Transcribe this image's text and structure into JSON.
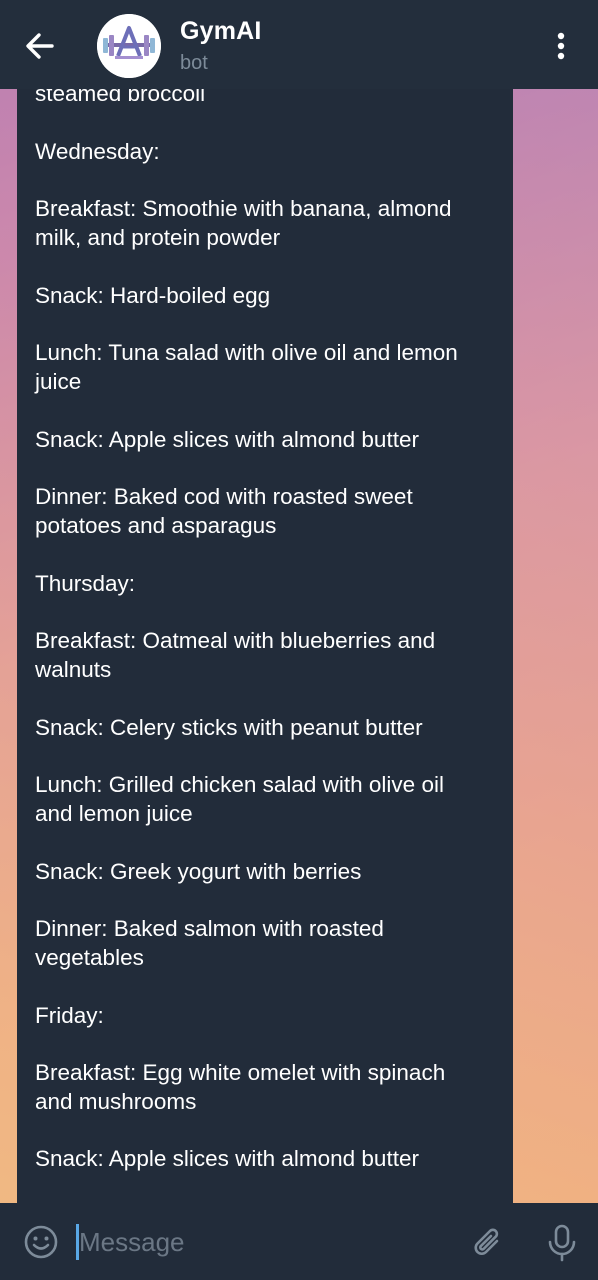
{
  "header": {
    "title": "GymAI",
    "subtitle": "bot",
    "back_icon": "arrow-left-icon",
    "menu_icon": "more-vertical-icon"
  },
  "message": {
    "lines": [
      "steamed broccoli",
      "",
      "Wednesday:",
      "",
      "Breakfast: Smoothie with banana, almond",
      "milk, and protein powder",
      "",
      "Snack: Hard-boiled egg",
      "",
      "Lunch: Tuna salad with olive oil and lemon",
      "juice",
      "",
      "Snack: Apple slices with almond butter",
      "",
      "Dinner: Baked cod with roasted sweet",
      "potatoes and asparagus",
      "",
      "Thursday:",
      "",
      "Breakfast: Oatmeal with blueberries and",
      "walnuts",
      "",
      "Snack: Celery sticks with peanut butter",
      "",
      "Lunch: Grilled chicken salad with olive oil",
      "and lemon juice",
      "",
      "Snack: Greek yogurt with berries",
      "",
      "Dinner: Baked salmon with roasted",
      "vegetables",
      "",
      "Friday:",
      "",
      "Breakfast: Egg white omelet with spinach",
      "and mushrooms",
      "",
      "Snack: Apple slices with almond butter"
    ]
  },
  "input": {
    "placeholder": "Message",
    "emoji_icon": "smiley-icon",
    "attach_icon": "paperclip-icon",
    "mic_icon": "microphone-icon"
  },
  "colors": {
    "header_bg": "#232e3c",
    "bubble_bg": "#222c3a",
    "accent": "#5aa8e6",
    "muted_text": "#7d8b99"
  }
}
